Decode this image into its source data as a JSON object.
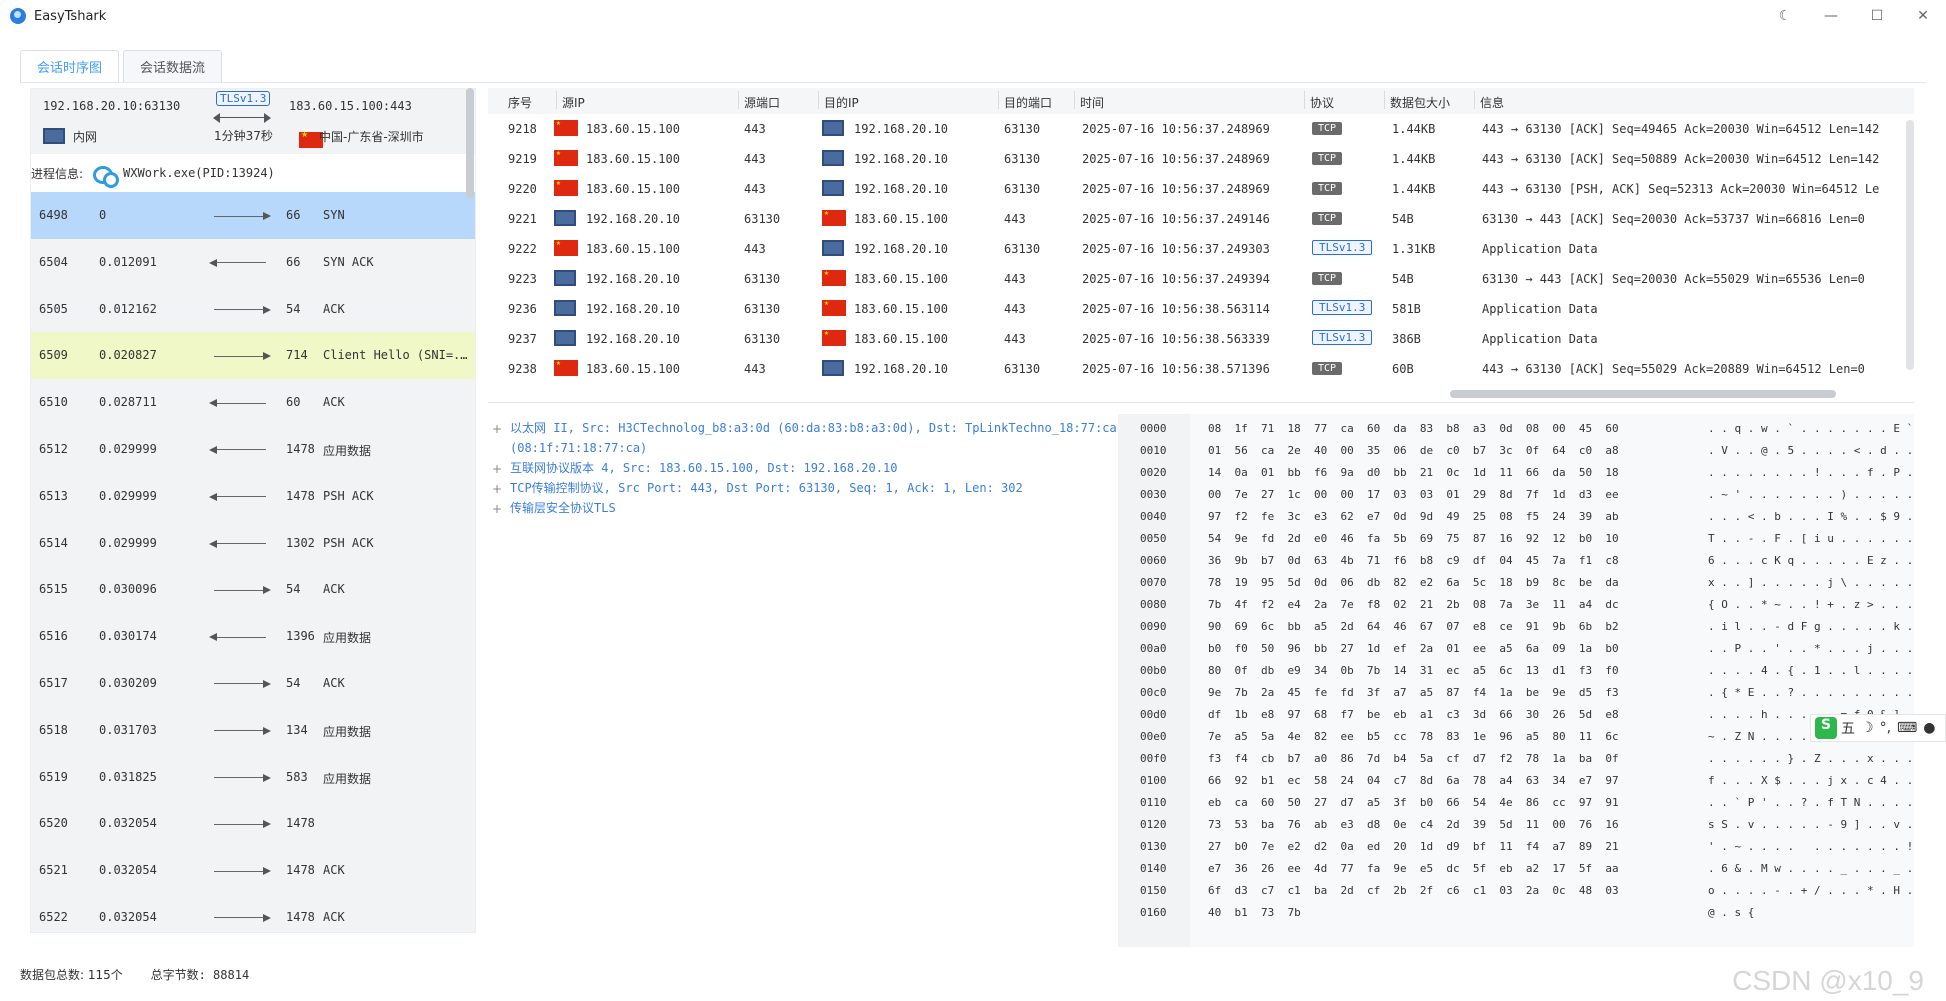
{
  "app": {
    "title": "EasyTshark"
  },
  "tabs": [
    {
      "label": "会话时序图",
      "active": true
    },
    {
      "label": "会话数据流",
      "active": false
    }
  ],
  "session": {
    "src": "192.168.20.10:63130",
    "dst": "183.60.15.100:443",
    "protocol": "TLSv1.3",
    "duration": "1分钟37秒",
    "src_label": "内网",
    "dst_label": "中国-广东省-深圳市",
    "process_label": "进程信息:",
    "process": "WXWork.exe(PID:13924)"
  },
  "sequence": [
    {
      "no": "6498",
      "time": "0",
      "dir": "right",
      "len": "66",
      "info": "SYN",
      "highlight": "#b8d8fb"
    },
    {
      "no": "6504",
      "time": "0.012091",
      "dir": "left",
      "len": "66",
      "info": "SYN ACK",
      "highlight": ""
    },
    {
      "no": "6505",
      "time": "0.012162",
      "dir": "right",
      "len": "54",
      "info": "ACK",
      "highlight": ""
    },
    {
      "no": "6509",
      "time": "0.020827",
      "dir": "right",
      "len": "714",
      "info": "Client Hello (SNI=...",
      "highlight": "#f0f8c8"
    },
    {
      "no": "6510",
      "time": "0.028711",
      "dir": "left",
      "len": "60",
      "info": "ACK",
      "highlight": ""
    },
    {
      "no": "6512",
      "time": "0.029999",
      "dir": "left",
      "len": "1478",
      "info": "应用数据",
      "highlight": ""
    },
    {
      "no": "6513",
      "time": "0.029999",
      "dir": "left",
      "len": "1478",
      "info": "PSH ACK",
      "highlight": ""
    },
    {
      "no": "6514",
      "time": "0.029999",
      "dir": "left",
      "len": "1302",
      "info": "PSH ACK",
      "highlight": ""
    },
    {
      "no": "6515",
      "time": "0.030096",
      "dir": "right",
      "len": "54",
      "info": "ACK",
      "highlight": ""
    },
    {
      "no": "6516",
      "time": "0.030174",
      "dir": "left",
      "len": "1396",
      "info": "应用数据",
      "highlight": ""
    },
    {
      "no": "6517",
      "time": "0.030209",
      "dir": "right",
      "len": "54",
      "info": "ACK",
      "highlight": ""
    },
    {
      "no": "6518",
      "time": "0.031703",
      "dir": "right",
      "len": "134",
      "info": "应用数据",
      "highlight": ""
    },
    {
      "no": "6519",
      "time": "0.031825",
      "dir": "right",
      "len": "583",
      "info": "应用数据",
      "highlight": ""
    },
    {
      "no": "6520",
      "time": "0.032054",
      "dir": "right",
      "len": "1478",
      "info": "",
      "highlight": ""
    },
    {
      "no": "6521",
      "time": "0.032054",
      "dir": "right",
      "len": "1478",
      "info": "ACK",
      "highlight": ""
    },
    {
      "no": "6522",
      "time": "0.032054",
      "dir": "right",
      "len": "1478",
      "info": "ACK",
      "highlight": ""
    }
  ],
  "packet_table": {
    "headers": [
      "序号",
      "源IP",
      "源端口",
      "目的IP",
      "目的端口",
      "时间",
      "协议",
      "数据包大小",
      "信息"
    ],
    "rows": [
      {
        "no": "9218",
        "src": "183.60.15.100",
        "src_type": "flag",
        "sport": "443",
        "dst": "192.168.20.10",
        "dst_type": "pc",
        "dport": "63130",
        "time": "2025-07-16 10:56:37.248969",
        "proto": "TCP",
        "size": "1.44KB",
        "info": "443 → 63130 [ACK] Seq=49465 Ack=20030 Win=64512 Len=142"
      },
      {
        "no": "9219",
        "src": "183.60.15.100",
        "src_type": "flag",
        "sport": "443",
        "dst": "192.168.20.10",
        "dst_type": "pc",
        "dport": "63130",
        "time": "2025-07-16 10:56:37.248969",
        "proto": "TCP",
        "size": "1.44KB",
        "info": "443 → 63130 [ACK] Seq=50889 Ack=20030 Win=64512 Len=142"
      },
      {
        "no": "9220",
        "src": "183.60.15.100",
        "src_type": "flag",
        "sport": "443",
        "dst": "192.168.20.10",
        "dst_type": "pc",
        "dport": "63130",
        "time": "2025-07-16 10:56:37.248969",
        "proto": "TCP",
        "size": "1.44KB",
        "info": "443 → 63130 [PSH, ACK] Seq=52313 Ack=20030 Win=64512 Le"
      },
      {
        "no": "9221",
        "src": "192.168.20.10",
        "src_type": "pc",
        "sport": "63130",
        "dst": "183.60.15.100",
        "dst_type": "flag",
        "dport": "443",
        "time": "2025-07-16 10:56:37.249146",
        "proto": "TCP",
        "size": "54B",
        "info": "63130 → 443 [ACK] Seq=20030 Ack=53737 Win=66816 Len=0"
      },
      {
        "no": "9222",
        "src": "183.60.15.100",
        "src_type": "flag",
        "sport": "443",
        "dst": "192.168.20.10",
        "dst_type": "pc",
        "dport": "63130",
        "time": "2025-07-16 10:56:37.249303",
        "proto": "TLSv1.3",
        "size": "1.31KB",
        "info": "Application Data"
      },
      {
        "no": "9223",
        "src": "192.168.20.10",
        "src_type": "pc",
        "sport": "63130",
        "dst": "183.60.15.100",
        "dst_type": "flag",
        "dport": "443",
        "time": "2025-07-16 10:56:37.249394",
        "proto": "TCP",
        "size": "54B",
        "info": "63130 → 443 [ACK] Seq=20030 Ack=55029 Win=65536 Len=0"
      },
      {
        "no": "9236",
        "src": "192.168.20.10",
        "src_type": "pc",
        "sport": "63130",
        "dst": "183.60.15.100",
        "dst_type": "flag",
        "dport": "443",
        "time": "2025-07-16 10:56:38.563114",
        "proto": "TLSv1.3",
        "size": "581B",
        "info": "Application Data"
      },
      {
        "no": "9237",
        "src": "192.168.20.10",
        "src_type": "pc",
        "sport": "63130",
        "dst": "183.60.15.100",
        "dst_type": "flag",
        "dport": "443",
        "time": "2025-07-16 10:56:38.563339",
        "proto": "TLSv1.3",
        "size": "386B",
        "info": "Application Data"
      },
      {
        "no": "9238",
        "src": "183.60.15.100",
        "src_type": "flag",
        "sport": "443",
        "dst": "192.168.20.10",
        "dst_type": "pc",
        "dport": "63130",
        "time": "2025-07-16 10:56:38.571396",
        "proto": "TCP",
        "size": "60B",
        "info": "443 → 63130 [ACK] Seq=55029 Ack=20889 Win=64512 Len=0"
      }
    ]
  },
  "detail_tree": [
    "以太网 II, Src: H3CTechnolog_b8:a3:0d (60:da:83:b8:a3:0d), Dst: TpLinkTechno_18:77:ca (08:1f:71:18:77:ca)",
    "互联网协议版本 4, Src: 183.60.15.100, Dst: 192.168.20.10",
    "TCP传输控制协议, Src Port: 443, Dst Port: 63130, Seq: 1, Ack: 1, Len: 302",
    "传输层安全协议TLS"
  ],
  "hex": [
    {
      "off": "0000",
      "bytes": "08  1f  71  18  77  ca  60  da  83  b8  a3  0d  08  00  45  60",
      "ascii": ". . q . w . ` . . . . . . . E `"
    },
    {
      "off": "0010",
      "bytes": "01  56  ca  2e  40  00  35  06  de  c0  b7  3c  0f  64  c0  a8",
      "ascii": ". V . . @ . 5 . . . . < . d . ."
    },
    {
      "off": "0020",
      "bytes": "14  0a  01  bb  f6  9a  d0  bb  21  0c  1d  11  66  da  50  18",
      "ascii": ". . . . . . . . ! . . . f . P ."
    },
    {
      "off": "0030",
      "bytes": "00  7e  27  1c  00  00  17  03  03  01  29  8d  7f  1d  d3  ee",
      "ascii": ". ~ ' . . . . . . . ) . . . . ."
    },
    {
      "off": "0040",
      "bytes": "97  f2  fe  3c  e3  62  e7  0d  9d  49  25  08  f5  24  39  ab",
      "ascii": ". . . < . b . . . I % . . $ 9 ."
    },
    {
      "off": "0050",
      "bytes": "54  9e  fd  2d  e0  46  fa  5b  69  75  87  16  92  12  b0  10",
      "ascii": "T . . - . F . [ i u . . . . . ."
    },
    {
      "off": "0060",
      "bytes": "36  9b  b7  0d  63  4b  71  f6  b8  c9  df  04  45  7a  f1  c8",
      "ascii": "6 . . . c K q . . . . . E z . ."
    },
    {
      "off": "0070",
      "bytes": "78  19  95  5d  0d  06  db  82  e2  6a  5c  18  b9  8c  be  da",
      "ascii": "x . . ] . . . . . j \\ . . . . ."
    },
    {
      "off": "0080",
      "bytes": "7b  4f  f2  e4  2a  7e  f8  02  21  2b  08  7a  3e  11  a4  dc",
      "ascii": "{ O . . * ~ . . ! + . z > . . ."
    },
    {
      "off": "0090",
      "bytes": "90  69  6c  bb  a5  2d  64  46  67  07  e8  ce  91  9b  6b  b2",
      "ascii": ". i l . . - d F g . . . . . k ."
    },
    {
      "off": "00a0",
      "bytes": "b0  f0  50  96  bb  27  1d  ef  2a  01  ee  a5  6a  09  1a  b0",
      "ascii": ". . P . . ' . . * . . . j . . ."
    },
    {
      "off": "00b0",
      "bytes": "80  0f  db  e9  34  0b  7b  14  31  ec  a5  6c  13  d1  f3  f0",
      "ascii": ". . . . 4 . { . 1 . . l . . . ."
    },
    {
      "off": "00c0",
      "bytes": "9e  7b  2a  45  fe  fd  3f  a7  a5  87  f4  1a  be  9e  d5  f3",
      "ascii": ". { * E . . ? . . . . . . . . ."
    },
    {
      "off": "00d0",
      "bytes": "df  1b  e8  97  68  f7  be  eb  a1  c3  3d  66  30  26  5d  e8",
      "ascii": ". . . . h . . . . . = f 0 & ] ."
    },
    {
      "off": "00e0",
      "bytes": "7e  a5  5a  4e  82  ee  b5  cc  78  83  1e  96  a5  80  11  6c",
      "ascii": "~ . Z N . . . . x . . . . . . l"
    },
    {
      "off": "00f0",
      "bytes": "f3  f4  cb  b7  a0  86  7d  b4  5a  cf  d7  f2  78  1a  ba  0f",
      "ascii": ". . . . . . } . Z . . . x . . ."
    },
    {
      "off": "0100",
      "bytes": "66  92  b1  ec  58  24  04  c7  8d  6a  78  a4  63  34  e7  97",
      "ascii": "f . . . X $ . . . j x . c 4 . ."
    },
    {
      "off": "0110",
      "bytes": "eb  ca  60  50  27  d7  a5  3f  b0  66  54  4e  86  cc  97  91",
      "ascii": ". . ` P ' . . ? . f T N . . . ."
    },
    {
      "off": "0120",
      "bytes": "73  53  ba  76  ab  e3  d8  0e  c4  2d  39  5d  11  00  76  16",
      "ascii": "s S . v . . . . . - 9 ] . . v ."
    },
    {
      "off": "0130",
      "bytes": "27  b0  7e  e2  d2  0a  ed  20  1d  d9  bf  11  f4  a7  89  21",
      "ascii": "' . ~ . . . .   . . . . . . . !"
    },
    {
      "off": "0140",
      "bytes": "e7  36  26  ee  4d  77  fa  9e  e5  dc  5f  eb  a2  17  5f  aa",
      "ascii": ". 6 & . M w . . . . _ . . . _ ."
    },
    {
      "off": "0150",
      "bytes": "6f  d3  c7  c1  ba  2d  cf  2b  2f  c6  c1  03  2a  0c  48  03",
      "ascii": "o . . . . - . + / . . . * . H ."
    },
    {
      "off": "0160",
      "bytes": "40  b1  73  7b",
      "ascii": "@ . s {"
    }
  ],
  "status": {
    "packets": "数据包总数: 115个",
    "bytes": "总字节数: 88814"
  },
  "watermark": "CSDN @x10_9",
  "ime": {
    "mode": "五"
  }
}
